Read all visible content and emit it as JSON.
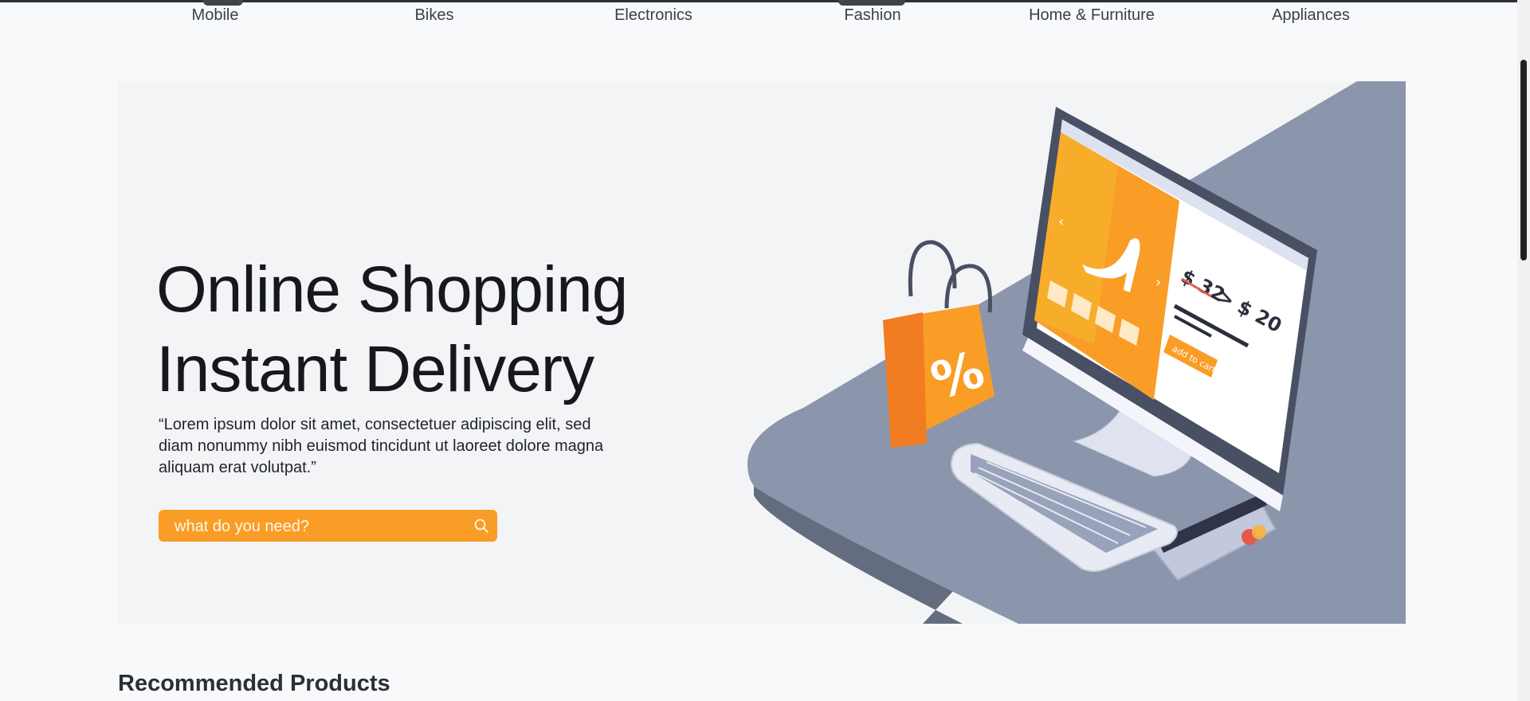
{
  "categories": [
    {
      "label": "Mobile"
    },
    {
      "label": "Bikes"
    },
    {
      "label": "Electronics"
    },
    {
      "label": "Fashion"
    },
    {
      "label": "Home & Furniture"
    },
    {
      "label": "Appliances"
    }
  ],
  "hero": {
    "title_line1": "Online Shopping",
    "title_line2": "Instant Delivery",
    "quote": "“Lorem ipsum dolor sit amet, consectetuer adipiscing elit, sed diam nonummy nibh euismod tincidunt ut laoreet dolore magna aliquam erat volutpat.”",
    "search_placeholder": "what do you need?",
    "search_icon": "search-icon",
    "art": {
      "old_price": "$ 32",
      "new_price": "> $ 20",
      "cta": "add to cart",
      "bag_symbol": "%"
    }
  },
  "sections": {
    "recommended_title": "Recommended Products"
  },
  "colors": {
    "accent": "#f99d27",
    "desk": "#8b96ac",
    "hero_bg": "#f3f4f6"
  }
}
